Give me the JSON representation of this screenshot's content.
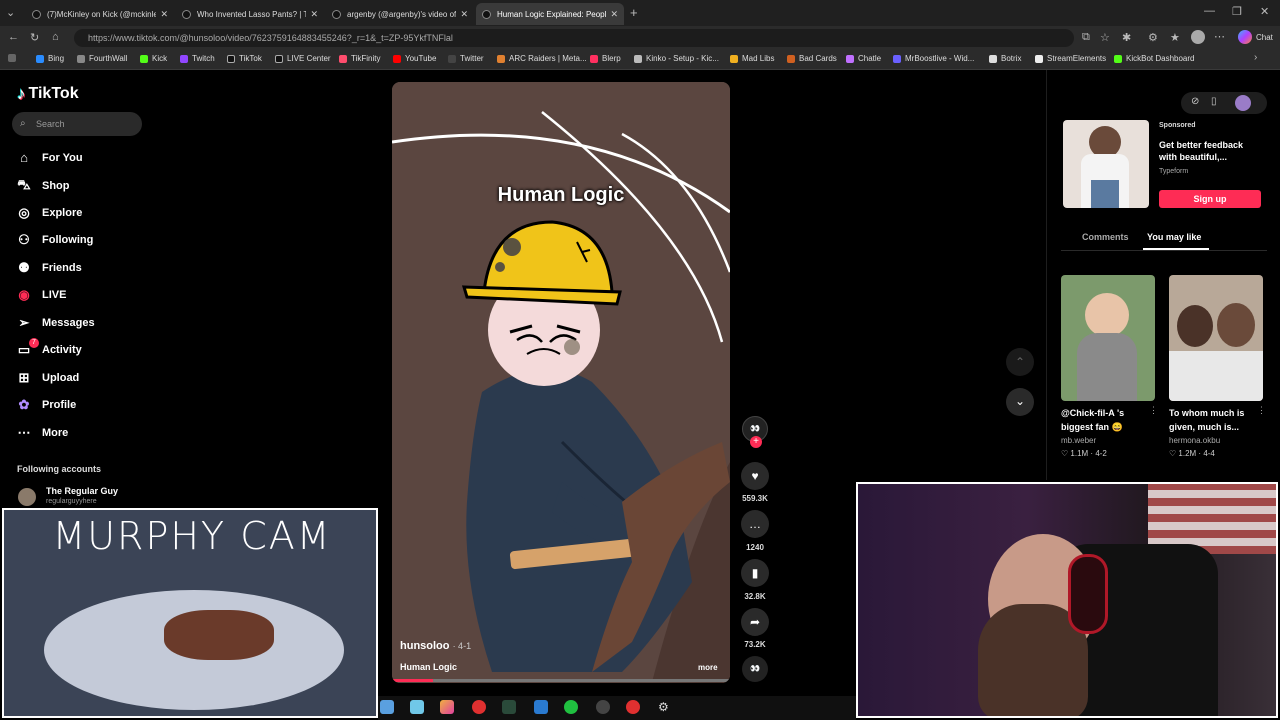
{
  "browser": {
    "tabs": [
      {
        "label": "(7)McKinley on Kick (@mckinley.tv"
      },
      {
        "label": "Who Invented Lasso Pants? | TikTo"
      },
      {
        "label": "argenby (@argenby)'s video of arg"
      },
      {
        "label": "Human Logic Explained: People's B"
      }
    ],
    "url": "https://www.tiktok.com/@hunsoloo/video/7623759164883455246?_r=1&_t=ZP-95YkfTNFlal",
    "chat_label": "Chat",
    "bookmarks": [
      {
        "label": "Bing"
      },
      {
        "label": "FourthWall"
      },
      {
        "label": "Kick"
      },
      {
        "label": "Twitch"
      },
      {
        "label": "TikTok"
      },
      {
        "label": "LIVE Center"
      },
      {
        "label": "TikFinity"
      },
      {
        "label": "YouTube"
      },
      {
        "label": "Twitter"
      },
      {
        "label": "ARC Raiders | Meta..."
      },
      {
        "label": "Blerp"
      },
      {
        "label": "Kinko - Setup - Kic..."
      },
      {
        "label": "Mad Libs"
      },
      {
        "label": "Bad Cards"
      },
      {
        "label": "Chatle"
      },
      {
        "label": "MrBoostlive - Wid..."
      },
      {
        "label": "Botrix"
      },
      {
        "label": "StreamElements"
      },
      {
        "label": "KickBot Dashboard"
      }
    ]
  },
  "tiktok": {
    "logo": "TikTok",
    "search_placeholder": "Search",
    "nav": [
      {
        "label": "For You",
        "icon": "home-icon"
      },
      {
        "label": "Shop",
        "icon": "shop-icon"
      },
      {
        "label": "Explore",
        "icon": "compass-icon"
      },
      {
        "label": "Following",
        "icon": "following-icon"
      },
      {
        "label": "Friends",
        "icon": "friends-icon"
      },
      {
        "label": "LIVE",
        "icon": "live-icon"
      },
      {
        "label": "Messages",
        "icon": "messages-icon"
      },
      {
        "label": "Activity",
        "icon": "activity-icon",
        "badge": "7"
      },
      {
        "label": "Upload",
        "icon": "upload-icon"
      },
      {
        "label": "Profile",
        "icon": "profile-icon"
      },
      {
        "label": "More",
        "icon": "more-icon"
      }
    ],
    "following_heading": "Following accounts",
    "following": [
      {
        "name": "The Regular Guy",
        "handle": "regularguyyhere"
      }
    ],
    "video": {
      "overlay_title": "Human Logic",
      "author": "hunsoloo",
      "date": "· 4-1",
      "caption": "Human Logic",
      "more": "more",
      "likes": "559.3K",
      "comments": "1240",
      "saves": "32.8K",
      "shares": "73.2K",
      "progress": 0.12
    },
    "sponsored": {
      "label": "Sponsored",
      "title": "Get better feedback with beautiful,...",
      "brand": "Typeform",
      "cta": "Sign up"
    },
    "panel_tabs": [
      "Comments",
      "You may like"
    ],
    "recommendations": [
      {
        "title": "@Chick-fil-A 's biggest fan 😄",
        "author": "mb.weber",
        "likes": "1.1M",
        "date": "4-2"
      },
      {
        "title": "To whom much is given, much is...",
        "author": "hermona.okbu",
        "likes": "1.2M",
        "date": "4-4"
      }
    ]
  },
  "overlay": {
    "cam_title": "MURPHY CAM"
  },
  "colors": {
    "tiktok_red": "#fe2c55",
    "video_bg": "#5b4640",
    "helmet": "#f0c419"
  }
}
